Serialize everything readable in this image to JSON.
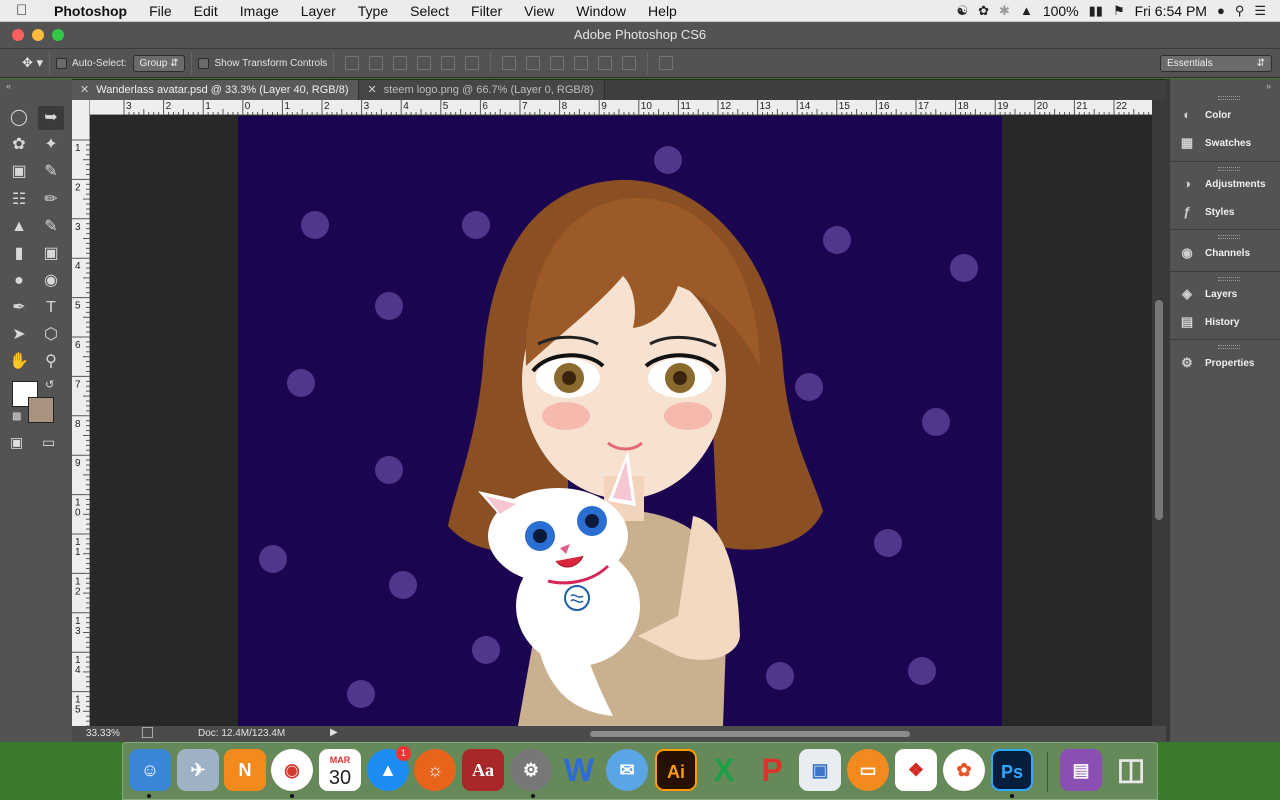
{
  "menubar": {
    "apple_icon": "apple-icon",
    "app_name": "Photoshop",
    "items": [
      "File",
      "Edit",
      "Image",
      "Layer",
      "Type",
      "Select",
      "Filter",
      "View",
      "Window",
      "Help"
    ],
    "battery": "100%",
    "clock": "Fri 6:54 PM"
  },
  "window": {
    "title": "Adobe Photoshop CS6"
  },
  "options": {
    "auto_select_label": "Auto-Select:",
    "auto_select_value": "Group",
    "show_transform_label": "Show Transform Controls",
    "workspace": "Essentials"
  },
  "tabs": [
    {
      "label": "Wanderlass avatar.psd @ 33.3% (Layer 40, RGB/8)",
      "active": true
    },
    {
      "label": "steem logo.png @ 66.7% (Layer 0, RGB/8)",
      "active": false
    }
  ],
  "ruler": {
    "h_labels": [
      "3",
      "2",
      "1",
      "0",
      "1",
      "2",
      "3",
      "4",
      "5",
      "6",
      "7",
      "8",
      "9",
      "10",
      "11",
      "12",
      "13",
      "14",
      "15",
      "16",
      "17",
      "18",
      "19",
      "20",
      "21",
      "22"
    ],
    "v_labels": [
      "1",
      "2",
      "3",
      "4",
      "5",
      "6",
      "7",
      "8",
      "9",
      "10",
      "11",
      "12",
      "13",
      "14",
      "15"
    ]
  },
  "status": {
    "zoom": "33.33%",
    "doc": "Doc: 12.4M/123.4M"
  },
  "colors": {
    "foreground": "#ffffff",
    "background": "#a89280",
    "canvas": "#1b0450"
  },
  "panels": [
    {
      "label": "Color",
      "icon": "color-icon"
    },
    {
      "label": "Swatches",
      "icon": "swatches-icon"
    },
    {
      "label": "Adjustments",
      "icon": "adjustments-icon"
    },
    {
      "label": "Styles",
      "icon": "styles-icon"
    },
    {
      "label": "Channels",
      "icon": "channels-icon"
    },
    {
      "label": "Layers",
      "icon": "layers-icon"
    },
    {
      "label": "History",
      "icon": "history-icon"
    },
    {
      "label": "Properties",
      "icon": "properties-icon"
    }
  ],
  "dock": {
    "calendar_month": "MAR",
    "calendar_day": "30",
    "appstore_badge": "1",
    "acrobat_label": "Ai",
    "photoshop_label": "Ps",
    "netnews_label": "N",
    "excel_label": "X",
    "word_label": "W",
    "dictionary_label": "Aa"
  }
}
